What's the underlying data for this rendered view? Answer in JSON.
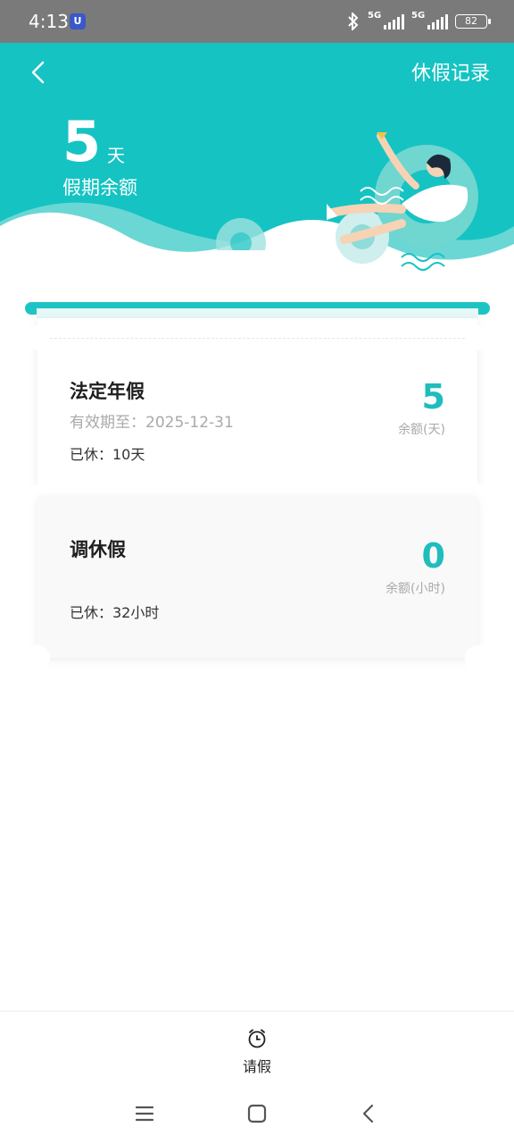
{
  "status_bar": {
    "time": "4:13",
    "app_badge": "U",
    "network_1": "5G",
    "network_2": "5G",
    "battery": "82"
  },
  "header": {
    "back_icon": "chevron-left-icon",
    "records_link": "休假记录",
    "balance_value": "5",
    "balance_unit": "天",
    "balance_label": "假期余额",
    "accent_color": "#15c3c3"
  },
  "leave_types": [
    {
      "name": "法定年假",
      "valid_until": "有效期至：2025-12-31",
      "used": "已休：10天",
      "balance": "5",
      "balance_label": "余额(天)"
    },
    {
      "name": "调休假",
      "used": "已休：32小时",
      "balance": "0",
      "balance_label": "余额(小时)"
    }
  ],
  "tabbar": {
    "icon": "alarm-clock-icon",
    "label": "请假"
  },
  "system_nav": {
    "menu": "menu-icon",
    "home": "home-icon",
    "back": "back-icon"
  }
}
